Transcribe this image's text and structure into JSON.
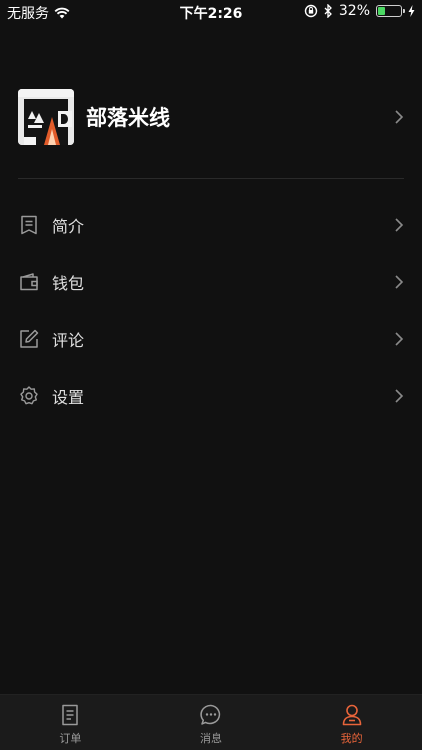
{
  "status_bar": {
    "carrier": "无服务",
    "time": "下午2:26",
    "battery": "32%",
    "battery_level": 0.32
  },
  "profile": {
    "name": "部落米线"
  },
  "menu": {
    "items": [
      {
        "label": "简介",
        "icon": "bookmark-note-icon"
      },
      {
        "label": "钱包",
        "icon": "wallet-icon"
      },
      {
        "label": "评论",
        "icon": "edit-icon"
      },
      {
        "label": "设置",
        "icon": "gear-icon"
      }
    ]
  },
  "tabbar": {
    "tabs": [
      {
        "label": "订单",
        "icon": "order-icon",
        "active": false
      },
      {
        "label": "消息",
        "icon": "message-icon",
        "active": false
      },
      {
        "label": "我的",
        "icon": "profile-icon",
        "active": true
      }
    ]
  },
  "colors": {
    "background": "#111111",
    "accent": "#e8643a",
    "battery_green": "#4cd964"
  }
}
